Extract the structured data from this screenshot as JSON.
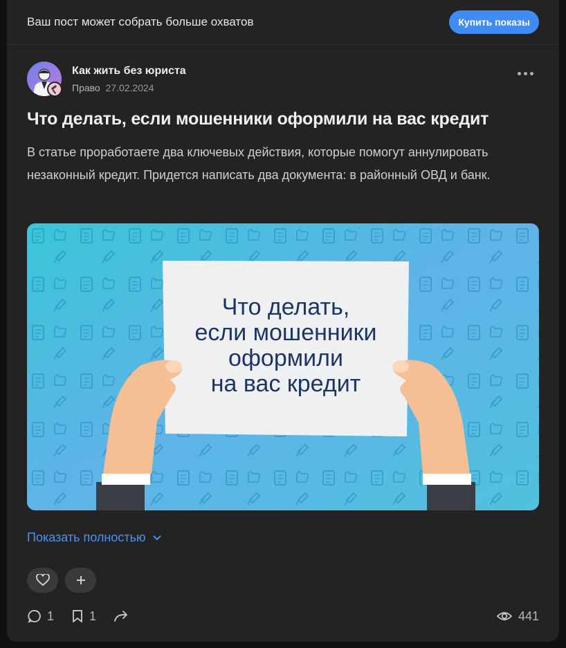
{
  "promo": {
    "text": "Ваш пост может собрать больше охватов",
    "button": "Купить показы"
  },
  "post": {
    "author": "Как жить без юриста",
    "category": "Право",
    "date": "27.02.2024",
    "title": "Что делать, если мошенники оформили на вас кредит",
    "description": "В статье проработаете два ключевых действия, которые помогут аннулировать незаконный кредит. Придется написать два документа: в районный ОВД и банк.",
    "cover_lines": [
      "Что делать,",
      "если мошенники",
      "оформили",
      "на вас кредит"
    ],
    "show_more": "Показать полностью"
  },
  "stats": {
    "comments": "1",
    "bookmarks": "1",
    "views": "441"
  },
  "colors": {
    "accent": "#3f8cf7",
    "link": "#4c91f2",
    "card": "#232324"
  },
  "icons": [
    "more-icon",
    "heart-icon",
    "plus-icon",
    "comment-icon",
    "bookmark-icon",
    "share-icon",
    "eye-icon",
    "chevron-down-icon"
  ]
}
